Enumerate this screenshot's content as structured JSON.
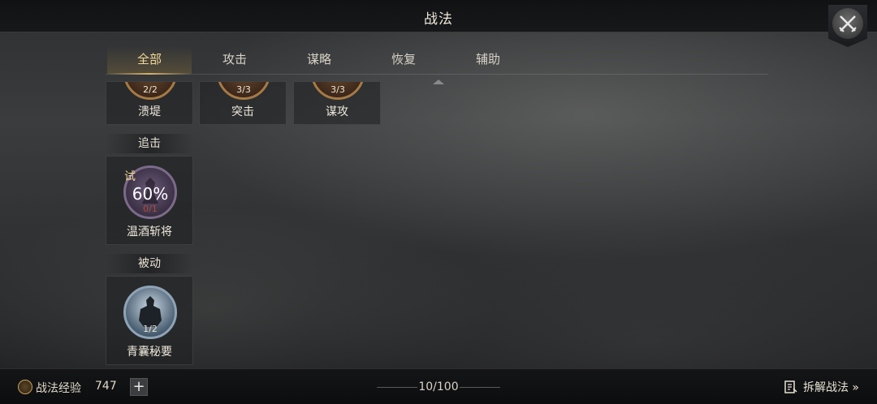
{
  "header": {
    "title": "战法"
  },
  "tabs": [
    {
      "label": "全部",
      "active": true
    },
    {
      "label": "攻击",
      "active": false
    },
    {
      "label": "谋略",
      "active": false
    },
    {
      "label": "恢复",
      "active": false
    },
    {
      "label": "辅助",
      "active": false
    }
  ],
  "active_cards": [
    {
      "name": "溃堤",
      "count": "2/2"
    },
    {
      "name": "突击",
      "count": "3/3"
    },
    {
      "name": "谋攻",
      "count": "3/3"
    }
  ],
  "sections": {
    "pursuit": {
      "label": "追击",
      "cards": [
        {
          "name": "温酒斩将",
          "badge": "试",
          "progress": "60%",
          "count": "0/1"
        }
      ]
    },
    "passive": {
      "label": "被动",
      "cards": [
        {
          "name": "青囊秘要",
          "count": "1/2"
        }
      ]
    }
  },
  "footer": {
    "exp_label": "战法经验",
    "exp_value": "747",
    "plus_label": "+",
    "capacity": "10/100",
    "disassemble_label": "拆解战法 »"
  },
  "colors": {
    "accent_gold": "#f2d89a",
    "medal_bronze": "#a57a44",
    "trial_red": "#b04a3a"
  }
}
